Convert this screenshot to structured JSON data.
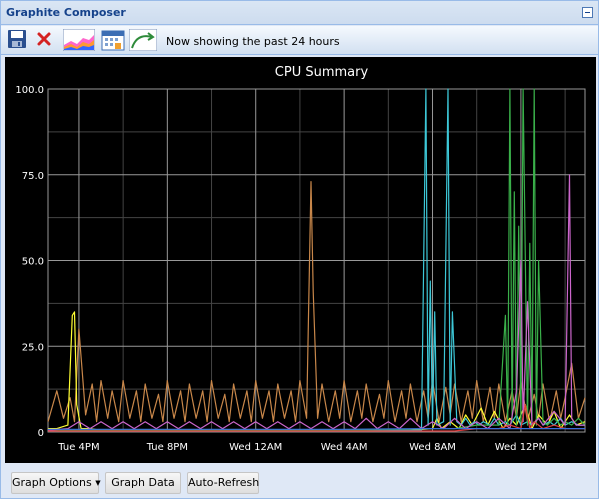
{
  "window": {
    "title": "Graphite Composer"
  },
  "toolbar": {
    "save_icon": "floppy-disk-icon",
    "delete_icon": "red-x-icon",
    "graph_icon": "stacked-area-chart-icon",
    "calendar_icon": "calendar-icon",
    "refresh_icon": "curve-arrow-icon",
    "status_text": "Now showing the past 24 hours"
  },
  "buttons": {
    "graph_options": "Graph Options",
    "graph_data": "Graph Data",
    "auto_refresh": "Auto-Refresh"
  },
  "colors": {
    "title_text": "#15428b",
    "panel_bg": "#dfe8f6",
    "panel_border": "#99bbe8",
    "graph_bg": "#000000",
    "grid_major": "#999999",
    "grid_minor": "#444444",
    "axis_text": "#ffffff"
  },
  "chart_data": {
    "type": "line",
    "title": "CPU Summary",
    "xlabel": "",
    "ylabel": "",
    "ylim": [
      0,
      100
    ],
    "ytick_labels": [
      "0",
      "25.0",
      "50.0",
      "75.0",
      "100.0"
    ],
    "yticks": [
      0,
      25,
      50,
      75,
      100
    ],
    "xlim": [
      14.6,
      38.9
    ],
    "xtick_labels": [
      "Tue  4PM",
      "Tue  8PM",
      "Wed 12AM",
      "Wed  4AM",
      "Wed  8AM",
      "Wed 12PM"
    ],
    "xticks": [
      16,
      20,
      24,
      28,
      32,
      36
    ],
    "grid": true,
    "series": [
      {
        "color": "#c8874a",
        "x": [
          14.6,
          15.0,
          15.3,
          15.6,
          15.8,
          16.0,
          16.3,
          16.6,
          16.8,
          17.0,
          17.3,
          17.5,
          17.8,
          18.0,
          18.3,
          18.6,
          18.8,
          19.0,
          19.3,
          19.6,
          19.8,
          20.0,
          20.3,
          20.6,
          20.8,
          21.0,
          21.3,
          21.6,
          21.8,
          22.0,
          22.3,
          22.6,
          22.8,
          23.0,
          23.3,
          23.6,
          23.8,
          24.0,
          24.3,
          24.6,
          24.8,
          25.0,
          25.3,
          25.6,
          25.8,
          26.0,
          26.3,
          26.5,
          26.6,
          26.8,
          27.0,
          27.3,
          27.6,
          27.8,
          28.0,
          28.3,
          28.6,
          28.8,
          29.0,
          29.3,
          29.6,
          29.8,
          30.0,
          30.3,
          30.6,
          30.8,
          31.0,
          31.3,
          31.6,
          31.8,
          32.0,
          32.3,
          32.6,
          32.8,
          33.0,
          33.3,
          33.6,
          33.8,
          34.0,
          34.3,
          34.6,
          34.8,
          35.0,
          35.3,
          35.6,
          35.8,
          36.0,
          36.3,
          36.6,
          36.8,
          37.0,
          37.3,
          37.6,
          37.8,
          38.0,
          38.3,
          38.6,
          38.9
        ],
        "y": [
          3,
          12,
          4,
          10,
          3,
          30,
          5,
          14,
          3,
          15,
          4,
          12,
          3,
          15,
          4,
          12,
          3,
          14,
          4,
          11,
          3,
          15,
          4,
          12,
          3,
          14,
          4,
          12,
          3,
          15,
          4,
          11,
          3,
          14,
          4,
          12,
          3,
          15,
          4,
          12,
          3,
          14,
          4,
          12,
          3,
          15,
          4,
          73,
          41,
          4,
          14,
          3,
          12,
          4,
          15,
          3,
          12,
          4,
          14,
          3,
          11,
          4,
          15,
          3,
          12,
          4,
          14,
          3,
          12,
          4,
          15,
          3,
          13,
          5,
          14,
          3,
          12,
          4,
          15,
          3,
          13,
          4,
          14,
          3,
          12,
          4,
          15,
          3,
          11,
          4,
          14,
          3,
          12,
          4,
          10,
          20,
          4,
          10
        ]
      },
      {
        "color": "#ffff33",
        "x": [
          14.6,
          15.0,
          15.5,
          15.7,
          15.8,
          15.9,
          16.1,
          16.5,
          17.0,
          20.0,
          24.0,
          28.0,
          31.0,
          32.0,
          32.2,
          32.4,
          32.8,
          33.2,
          33.5,
          33.8,
          34.2,
          34.5,
          34.8,
          35.2,
          35.5,
          35.8,
          36.2,
          36.5,
          36.8,
          37.2,
          37.5,
          37.8,
          38.2,
          38.5,
          38.9
        ],
        "y": [
          1,
          1,
          2,
          34,
          35,
          8,
          1,
          1,
          0.5,
          0.5,
          0.5,
          0.5,
          0.5,
          1,
          4,
          1,
          3,
          1,
          5,
          2,
          7,
          2,
          6,
          1,
          4,
          2,
          8,
          1,
          5,
          2,
          6,
          1,
          5,
          2,
          3
        ]
      },
      {
        "color": "#3dc8d8",
        "x": [
          14.6,
          20.0,
          28.0,
          31.5,
          31.7,
          31.8,
          31.9,
          32.0,
          32.1,
          32.2,
          32.5,
          32.7,
          32.8,
          32.9,
          33.1,
          33.3,
          33.5,
          33.7,
          33.9,
          34.1,
          34.3,
          34.6,
          34.8,
          35.0,
          35.3,
          35.5,
          35.8,
          36.0,
          36.3,
          36.5,
          36.8,
          37.0,
          37.3,
          37.5,
          37.8,
          38.0,
          38.3,
          38.6,
          38.9
        ],
        "y": [
          0.5,
          0.5,
          0.5,
          0.5,
          100,
          2,
          44,
          3,
          35,
          2,
          3,
          100,
          2,
          35,
          3,
          2,
          4,
          2,
          3,
          2,
          3,
          2,
          4,
          2,
          3,
          2,
          5,
          2,
          3,
          2,
          4,
          2,
          3,
          2,
          4,
          2,
          3,
          2,
          2
        ]
      },
      {
        "color": "#3ab04a",
        "x": [
          14.6,
          20.0,
          28.0,
          32.0,
          33.0,
          34.0,
          35.0,
          35.3,
          35.4,
          35.5,
          35.6,
          35.7,
          35.8,
          35.9,
          36.0,
          36.1,
          36.3,
          36.4,
          36.5,
          36.6,
          36.7,
          36.8,
          37.0,
          37.2,
          37.5,
          37.8,
          38.0,
          38.3,
          38.6,
          38.9
        ],
        "y": [
          0.5,
          0.5,
          0.5,
          1,
          1,
          2,
          2,
          34,
          2,
          100,
          3,
          70,
          2,
          60,
          3,
          100,
          2,
          55,
          3,
          100,
          2,
          50,
          3,
          2,
          4,
          2,
          3,
          2,
          4,
          2
        ]
      },
      {
        "color": "#cc66cc",
        "x": [
          14.6,
          15.5,
          16.0,
          16.5,
          17.0,
          17.5,
          18.0,
          18.5,
          19.0,
          19.5,
          20.0,
          20.5,
          21.0,
          21.5,
          22.0,
          22.5,
          23.0,
          23.5,
          24.0,
          24.5,
          25.0,
          25.5,
          26.0,
          26.5,
          27.0,
          27.5,
          28.0,
          28.5,
          29.0,
          29.5,
          30.0,
          30.5,
          31.0,
          31.5,
          32.0,
          32.5,
          33.0,
          33.5,
          34.0,
          34.5,
          35.0,
          35.5,
          35.8,
          36.0,
          36.1,
          36.3,
          36.5,
          36.8,
          37.0,
          37.5,
          38.0,
          38.2,
          38.3,
          38.5,
          38.9
        ],
        "y": [
          0.5,
          1,
          3,
          1,
          3,
          1,
          3,
          1,
          3,
          1,
          3,
          1,
          3,
          1,
          3,
          1,
          3,
          1,
          3,
          1,
          3,
          1,
          3,
          1,
          3,
          1,
          3,
          1,
          4,
          1,
          3,
          1,
          4,
          1,
          3,
          1,
          4,
          1,
          3,
          1,
          4,
          1,
          12,
          50,
          3,
          38,
          2,
          4,
          2,
          6,
          2,
          75,
          4,
          2,
          2
        ]
      },
      {
        "color": "#e03c3c",
        "x": [
          14.6,
          20.0,
          28.0,
          33.0,
          34.0,
          35.0,
          35.5,
          36.0,
          36.2,
          36.4,
          36.6,
          37.0,
          37.5,
          38.0,
          38.9
        ],
        "y": [
          0.3,
          0.3,
          0.3,
          0.3,
          1,
          1,
          2,
          1,
          8,
          1,
          3,
          1,
          2,
          1,
          1
        ]
      },
      {
        "color": "#3a6ed8",
        "x": [
          14.6,
          20.0,
          28.0,
          32.0,
          34.0,
          36.0,
          38.9
        ],
        "y": [
          0.8,
          0.8,
          0.8,
          1,
          1,
          1,
          1
        ]
      }
    ]
  }
}
